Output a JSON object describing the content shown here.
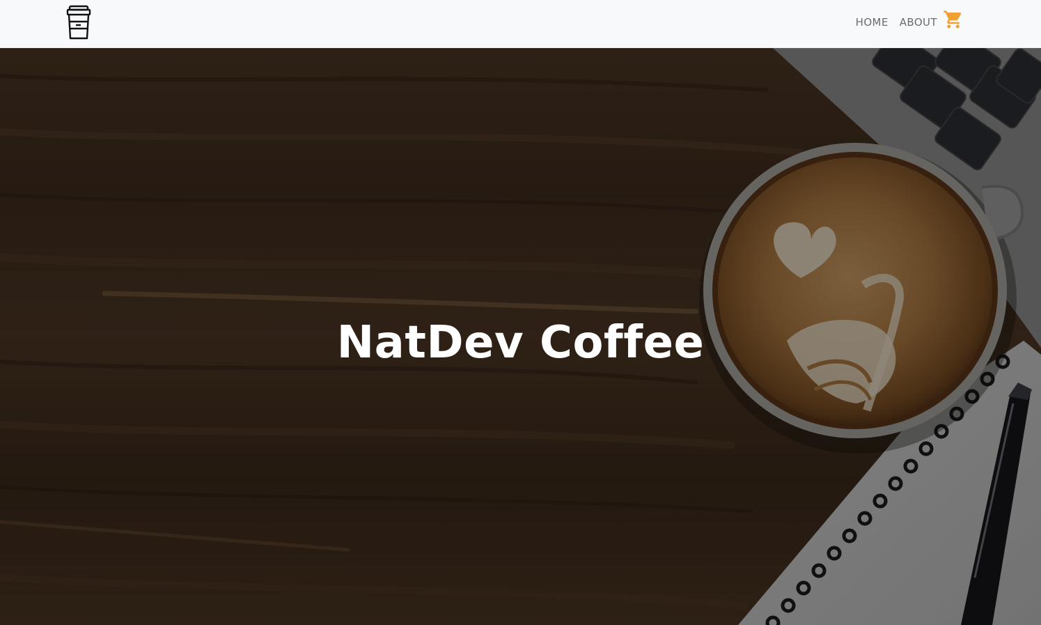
{
  "brand": {
    "icon": "coffee-cup-icon"
  },
  "nav": {
    "links": [
      {
        "label": "HOME"
      },
      {
        "label": "ABOUT"
      }
    ],
    "cart_icon": "shopping-cart-icon"
  },
  "hero": {
    "title": "NatDev Coffee"
  },
  "colors": {
    "navbar_bg": "#f8f9fa",
    "nav_link": "#6c6c6c",
    "cart_accent": "#f0a030",
    "hero_text": "#ffffff"
  }
}
